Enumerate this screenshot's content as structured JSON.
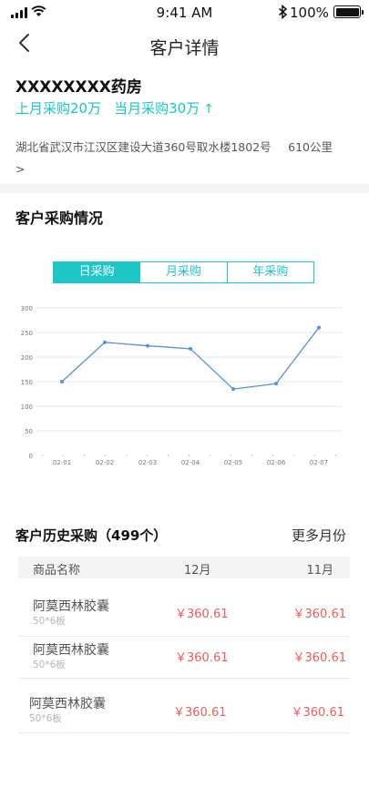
{
  "status_bar": {
    "time": "9:41 AM",
    "battery": "100%"
  },
  "nav": {
    "title": "客户详情"
  },
  "customer": {
    "name": "XXXXXXXX药房",
    "last_month": "上月采购20万",
    "this_month": "当月采购30万",
    "address": "湖北省武汉市江汉区建设大道360号取水楼1802号 >",
    "distance": "610公里"
  },
  "purchase_section": {
    "title": "客户采购情况",
    "tabs": [
      "日采购",
      "月采购",
      "年采购"
    ],
    "active_tab": 0
  },
  "chart_data": {
    "type": "line",
    "x": [
      "02-01",
      "02-02",
      "02-03",
      "02-04",
      "02-05",
      "02-06",
      "02-07"
    ],
    "series": [
      {
        "values": [
          150,
          230,
          223,
          217,
          135,
          146,
          260
        ]
      }
    ],
    "yticks": [
      0,
      50,
      100,
      150,
      200,
      250,
      300
    ],
    "ylim": [
      0,
      300
    ],
    "grid": true,
    "line_color": "#5a8fd8"
  },
  "history": {
    "title": "客户历史采购（499个）",
    "more": "更多月份",
    "columns": [
      "商品名称",
      "12月",
      "11月"
    ],
    "rows": [
      {
        "name": "阿莫西林胶囊",
        "spec": "50*6板",
        "m12": "￥360.61",
        "m11": "￥360.61"
      },
      {
        "name": "阿莫西林胶囊",
        "spec": "50*6板",
        "m12": "￥360.61",
        "m11": "￥360.61"
      },
      {
        "name": "阿莫西林胶囊",
        "spec": "50*6板",
        "m12": "￥360.61",
        "m11": "￥360.61"
      }
    ]
  }
}
